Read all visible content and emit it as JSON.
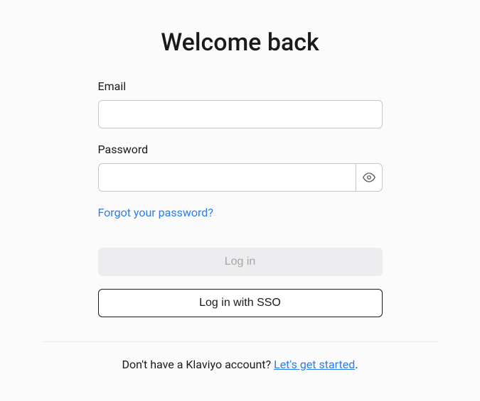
{
  "title": "Welcome back",
  "email": {
    "label": "Email",
    "value": ""
  },
  "password": {
    "label": "Password",
    "value": ""
  },
  "forgot_password": "Forgot your password?",
  "login_button": "Log in",
  "sso_button": "Log in with SSO",
  "footer": {
    "prompt": "Don't have a Klaviyo account? ",
    "link": "Let's get started",
    "suffix": "."
  }
}
